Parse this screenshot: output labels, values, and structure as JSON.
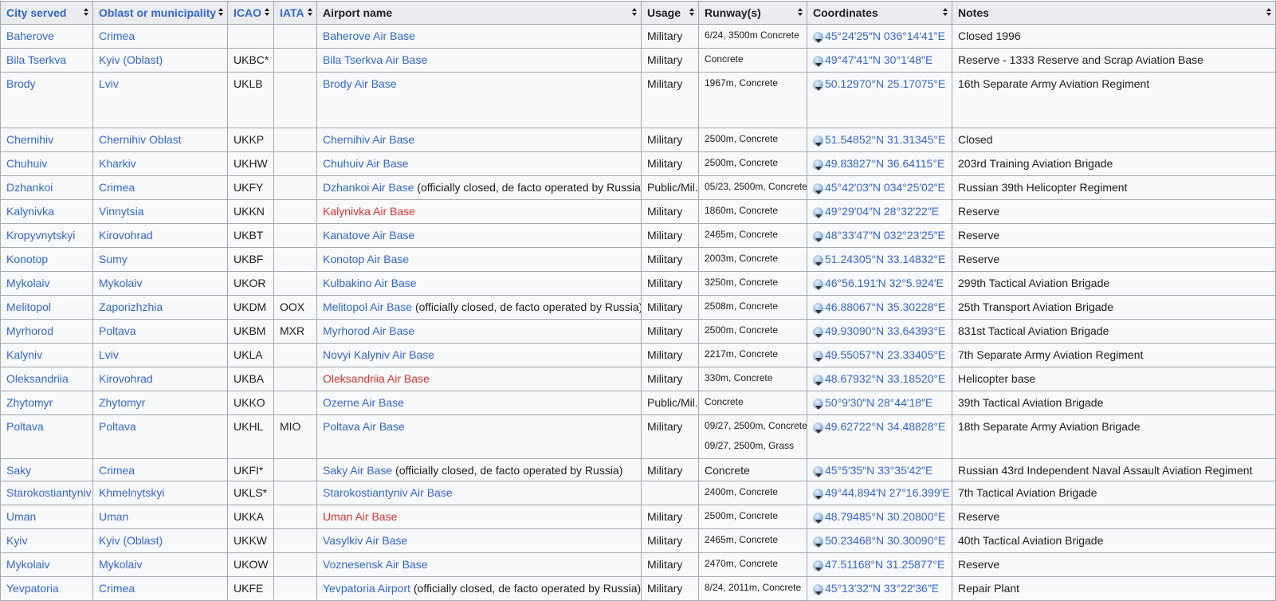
{
  "headers": [
    {
      "label": "City served",
      "link": true
    },
    {
      "label": "Oblast or municipality",
      "link": true
    },
    {
      "label": "ICAO",
      "link": true
    },
    {
      "label": "IATA",
      "link": true
    },
    {
      "label": "Airport name",
      "link": false
    },
    {
      "label": "Usage",
      "link": false
    },
    {
      "label": "Runway(s)",
      "link": false
    },
    {
      "label": "Coordinates",
      "link": false
    },
    {
      "label": "Notes",
      "link": false
    }
  ],
  "colors": {
    "link": "#3366cc",
    "redlink": "#d73333",
    "header_bg": "#eaecf0",
    "cell_bg": "#f8f9fa",
    "border": "#a2a9b1"
  },
  "rows": [
    {
      "city": "Baherove",
      "oblast": "Crimea",
      "icao": "",
      "iata": "",
      "airport": "Baherove Air Base",
      "red": false,
      "airport_note": "",
      "usage": "Military",
      "runway": [
        "6/24, 3500m Concrete"
      ],
      "coords": "45°24′25″N 036°14′41″E",
      "notes": "Closed 1996"
    },
    {
      "city": "Bila Tserkva",
      "oblast": "Kyiv (Oblast)",
      "icao": "UKBC*",
      "iata": "",
      "airport": "Bila Tserkva Air Base",
      "red": false,
      "airport_note": "",
      "usage": "Military",
      "runway": [
        "Concrete"
      ],
      "coords": "49°47′41″N 30°1′48″E",
      "notes": "Reserve - 1333 Reserve and Scrap Aviation Base"
    },
    {
      "city": "Brody",
      "oblast": "Lviv",
      "icao": "UKLB",
      "iata": "",
      "airport": "Brody Air Base",
      "red": false,
      "airport_note": "",
      "usage": "Military",
      "runway": [
        "1967m, Concrete"
      ],
      "coords": "50.12970°N 25.17075°E",
      "notes": "16th Separate Army Aviation Regiment",
      "tall": true
    },
    {
      "city": "Chernihiv",
      "oblast": "Chernihiv Oblast",
      "icao": "UKKP",
      "iata": "",
      "airport": "Chernihiv Air Base",
      "red": false,
      "airport_note": "",
      "usage": "Military",
      "runway": [
        "2500m, Concrete"
      ],
      "coords": "51.54852°N 31.31345°E",
      "notes": "Closed"
    },
    {
      "city": "Chuhuiv",
      "oblast": "Kharkiv",
      "icao": "UKHW",
      "iata": "",
      "airport": "Chuhuiv Air Base",
      "red": false,
      "airport_note": "",
      "usage": "Military",
      "runway": [
        "2500m, Concrete"
      ],
      "coords": "49.83827°N 36.64115°E",
      "notes": "203rd Training Aviation Brigade"
    },
    {
      "city": "Dzhankoi",
      "oblast": "Crimea",
      "icao": "UKFY",
      "iata": "",
      "airport": "Dzhankoi Air Base",
      "red": false,
      "airport_note": " (officially closed, de facto operated by Russia)",
      "usage": "Public/Mil.",
      "runway": [
        "05/23, 2500m, Concrete"
      ],
      "coords": "45°42′03″N 034°25′02″E",
      "notes": "Russian 39th Helicopter Regiment"
    },
    {
      "city": "Kalynivka",
      "oblast": "Vinnytsia",
      "icao": "UKKN",
      "iata": "",
      "airport": "Kalynivka Air Base",
      "red": true,
      "airport_note": "",
      "usage": "Military",
      "runway": [
        "1860m, Concrete"
      ],
      "coords": "49°29′04″N 28°32′22″E",
      "notes": "Reserve"
    },
    {
      "city": "Kropyvnytskyi",
      "oblast": "Kirovohrad",
      "icao": "UKBT",
      "iata": "",
      "airport": "Kanatove Air Base",
      "red": false,
      "airport_note": "",
      "usage": "Military",
      "runway": [
        "2465m, Concrete"
      ],
      "coords": "48°33′47″N 032°23′25″E",
      "notes": "Reserve"
    },
    {
      "city": "Konotop",
      "oblast": "Sumy",
      "icao": "UKBF",
      "iata": "",
      "airport": "Konotop Air Base",
      "red": false,
      "airport_note": "",
      "usage": "Military",
      "runway": [
        "2003m, Concrete"
      ],
      "coords": "51.24305°N 33.14832°E",
      "notes": "Reserve"
    },
    {
      "city": "Mykolaiv",
      "oblast": "Mykolaiv",
      "icao": "UKOR",
      "iata": "",
      "airport": "Kulbakino Air Base",
      "red": false,
      "airport_note": "",
      "usage": "Military",
      "runway": [
        "3250m, Concrete"
      ],
      "coords": "46°56.191′N 32°5.924′E",
      "notes": "299th Tactical Aviation Brigade"
    },
    {
      "city": "Melitopol",
      "oblast": "Zaporizhzhia",
      "icao": "UKDM",
      "iata": "OOX",
      "airport": "Melitopol Air Base",
      "red": false,
      "airport_note": " (officially closed, de facto operated by Russia)",
      "usage": "Military",
      "runway": [
        "2508m, Concrete"
      ],
      "coords": "46.88067°N 35.30228°E",
      "notes": "25th Transport Aviation Brigade"
    },
    {
      "city": "Myrhorod",
      "oblast": "Poltava",
      "icao": "UKBM",
      "iata": "MXR",
      "airport": "Myrhorod Air Base",
      "red": false,
      "airport_note": "",
      "usage": "Military",
      "runway": [
        "2500m, Concrete"
      ],
      "coords": "49.93090°N 33.64393°E",
      "notes": "831st Tactical Aviation Brigade"
    },
    {
      "city": "Kalyniv",
      "oblast": "Lviv",
      "icao": "UKLA",
      "iata": "",
      "airport": "Novyi Kalyniv Air Base",
      "red": false,
      "airport_note": "",
      "usage": "Military",
      "runway": [
        "2217m, Concrete"
      ],
      "coords": "49.55057°N 23.33405°E",
      "notes": "7th Separate Army Aviation Regiment"
    },
    {
      "city": "Oleksandriia",
      "oblast": "Kirovohrad",
      "icao": "UKBA",
      "iata": "",
      "airport": "Oleksandriia Air Base",
      "red": true,
      "airport_note": "",
      "usage": "Military",
      "runway": [
        "330m, Concrete"
      ],
      "coords": "48.67932°N 33.18520°E",
      "notes": "Helicopter base"
    },
    {
      "city": "Zhytomyr",
      "oblast": "Zhytomyr",
      "icao": "UKKO",
      "iata": "",
      "airport": "Ozerne Air Base",
      "red": false,
      "airport_note": "",
      "usage": "Public/Mil.",
      "runway": [
        "Concrete"
      ],
      "coords": "50°9′30″N 28°44′18″E",
      "notes": "39th Tactical Aviation Brigade"
    },
    {
      "city": "Poltava",
      "oblast": "Poltava",
      "icao": "UKHL",
      "iata": "MIO",
      "airport": "Poltava Air Base",
      "red": false,
      "airport_note": "",
      "usage": "Military",
      "runway": [
        "09/27, 2500m, Concrete",
        "09/27, 2500m, Grass"
      ],
      "coords": "49.62722°N 34.48828°E",
      "notes": "18th Separate Army Aviation Brigade"
    },
    {
      "city": "Saky",
      "oblast": "Crimea",
      "icao": "UKFI*",
      "iata": "",
      "airport": "Saky Air Base",
      "red": false,
      "airport_note": " (officially closed, de facto operated by Russia)",
      "usage": "Military",
      "runway": [
        "Concrete"
      ],
      "runway_big": true,
      "coords": "45°5′35″N 33°35′42″E",
      "notes": "Russian 43rd Independent Naval Assault Aviation Regiment"
    },
    {
      "city": "Starokostiantyniv",
      "oblast": "Khmelnytskyi",
      "icao": "UKLS*",
      "iata": "",
      "airport": "Starokostiantyniv Air Base",
      "red": false,
      "airport_note": "",
      "usage": "",
      "runway": [
        "2400m, Concrete"
      ],
      "coords": "49°44.894′N 27°16.399′E",
      "notes": "7th Tactical Aviation Brigade"
    },
    {
      "city": "Uman",
      "oblast": "Uman",
      "icao": "UKKA",
      "iata": "",
      "airport": "Uman Air Base",
      "red": true,
      "airport_note": "",
      "usage": "Military",
      "runway": [
        "2500m, Concrete"
      ],
      "coords": "48.79485°N 30.20800°E",
      "notes": "Reserve"
    },
    {
      "city": "Kyiv",
      "oblast": "Kyiv (Oblast)",
      "icao": "UKKW",
      "iata": "",
      "airport": "Vasylkiv Air Base",
      "red": false,
      "airport_note": "",
      "usage": "Military",
      "runway": [
        "2465m, Concrete"
      ],
      "coords": "50.23468°N 30.30090°E",
      "notes": "40th Tactical Aviation Brigade"
    },
    {
      "city": "Mykolaiv",
      "oblast": "Mykolaiv",
      "icao": "UKOW",
      "iata": "",
      "airport": "Voznesensk Air Base",
      "red": false,
      "airport_note": "",
      "usage": "Military",
      "runway": [
        "2470m, Concrete"
      ],
      "coords": "47.51168°N 31.25877°E",
      "notes": "Reserve"
    },
    {
      "city": "Yevpatoria",
      "oblast": "Crimea",
      "icao": "UKFE",
      "iata": "",
      "airport": "Yevpatoria Airport",
      "red": false,
      "airport_note": " (officially closed, de facto operated by Russia)",
      "usage": "Military",
      "runway": [
        "8/24, 2011m, Concrete"
      ],
      "coords": "45°13′32″N 33°22′36″E",
      "notes": "Repair Plant"
    }
  ]
}
